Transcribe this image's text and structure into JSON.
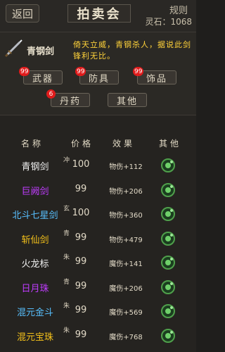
{
  "header": {
    "back_label": "返回",
    "title": "拍卖会",
    "rules_label": "规则",
    "fame_text": "灵石：1068"
  },
  "featured": {
    "icon": "sword-icon",
    "name": "青钢剑",
    "description": "倚天立威，青钢杀人，据说此剑锋利无比。"
  },
  "categories": [
    {
      "label": "武器",
      "badge": "99"
    },
    {
      "label": "防具",
      "badge": "99"
    },
    {
      "label": "饰品",
      "badge": "99"
    },
    {
      "label": "丹药",
      "badge": "6"
    },
    {
      "label": "其他",
      "badge": ""
    }
  ],
  "table": {
    "headers": [
      "名称",
      "价格",
      "效果",
      "其他"
    ],
    "rows": [
      {
        "name": "青钢剑",
        "tag": "冲",
        "price": "100",
        "effect": "物伤+112",
        "color": "#f0f0f0"
      },
      {
        "name": "巨阙剑",
        "tag": "",
        "price": "99",
        "effect": "物伤+206",
        "color": "#c03cff"
      },
      {
        "name": "北斗七星剑",
        "tag": "玄",
        "price": "100",
        "effect": "物伤+360",
        "color": "#58c0ff"
      },
      {
        "name": "斩仙剑",
        "tag": "青",
        "price": "99",
        "effect": "物伤+479",
        "color": "#f5c21a"
      },
      {
        "name": "火龙标",
        "tag": "朱",
        "price": "99",
        "effect": "魔伤+141",
        "color": "#f0f0f0"
      },
      {
        "name": "日月珠",
        "tag": "青",
        "price": "99",
        "effect": "魔伤+206",
        "color": "#c03cff"
      },
      {
        "name": "混元金斗",
        "tag": "朱",
        "price": "99",
        "effect": "魔伤+569",
        "color": "#58c0ff"
      },
      {
        "name": "混元宝珠",
        "tag": "朱",
        "price": "99",
        "effect": "魔伤+768",
        "color": "#f5c21a"
      }
    ]
  }
}
